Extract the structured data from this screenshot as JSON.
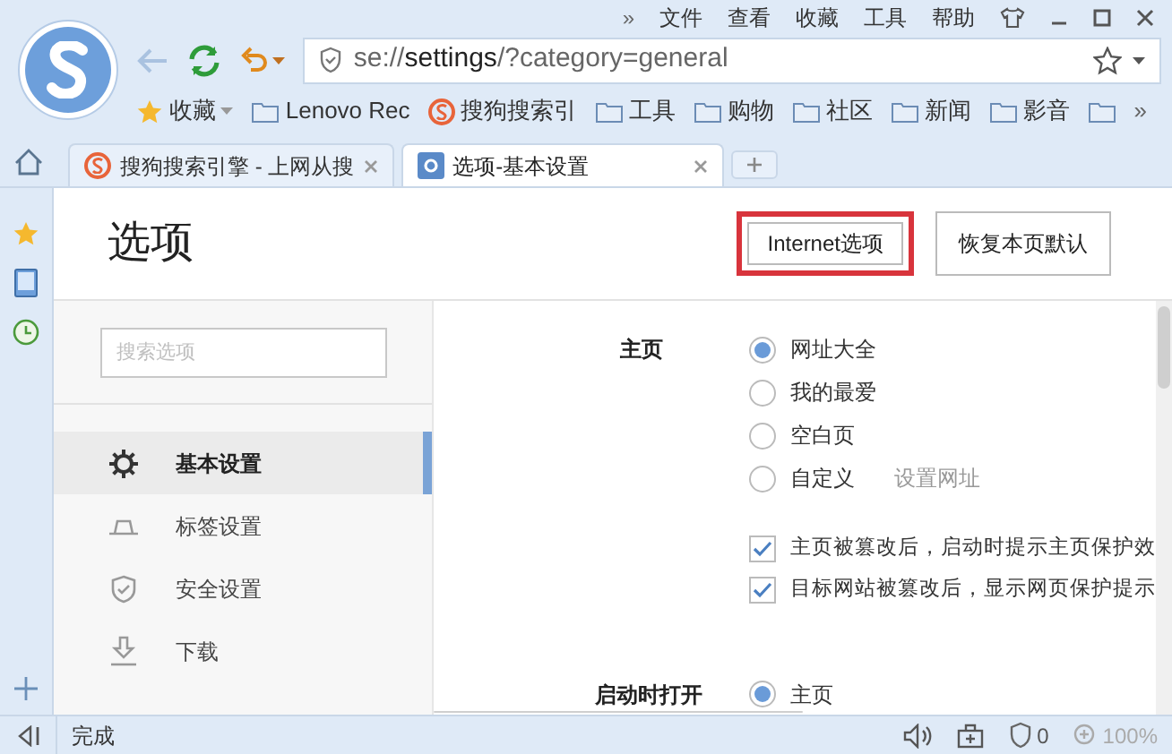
{
  "menu_bar": {
    "overflow": "»",
    "items": [
      "文件",
      "查看",
      "收藏",
      "工具",
      "帮助"
    ]
  },
  "address_bar": {
    "prefix": "se://",
    "bold": "settings",
    "suffix": "/?category=general"
  },
  "bookmarks": {
    "items": [
      {
        "kind": "favorites",
        "label": "收藏"
      },
      {
        "kind": "folder",
        "label": "Lenovo Rec"
      },
      {
        "kind": "site",
        "label": "搜狗搜索引"
      },
      {
        "kind": "folder",
        "label": "工具"
      },
      {
        "kind": "folder",
        "label": "购物"
      },
      {
        "kind": "folder",
        "label": "社区"
      },
      {
        "kind": "folder",
        "label": "新闻"
      },
      {
        "kind": "folder",
        "label": "影音"
      },
      {
        "kind": "folder"
      }
    ],
    "overflow": "»"
  },
  "tabs": [
    {
      "kind": "site",
      "label": "搜狗搜索引擎 - 上网从搜",
      "selected": false
    },
    {
      "kind": "settings",
      "label": "选项-基本设置",
      "selected": true
    }
  ],
  "page": {
    "title": "选项",
    "buttons": [
      {
        "label": "Internet选项",
        "highlighted": true
      },
      {
        "label": "恢复本页默认",
        "highlighted": false
      }
    ],
    "search": {
      "placeholder": "搜索选项"
    },
    "nav": [
      {
        "kind": "gear",
        "label": "基本设置",
        "selected": true
      },
      {
        "kind": "tab",
        "label": "标签设置",
        "selected": false
      },
      {
        "kind": "shield",
        "label": "安全设置",
        "selected": false
      },
      {
        "kind": "download",
        "label": "下载",
        "selected": false
      }
    ],
    "homepage": {
      "label": "主页",
      "options": [
        {
          "label": "网址大全",
          "selected": true
        },
        {
          "label": "我的最爱",
          "selected": false
        },
        {
          "label": "空白页",
          "selected": false
        },
        {
          "label": "自定义",
          "selected": false
        }
      ],
      "link": "设置网址",
      "checks": [
        {
          "label": "主页被篡改后，启动时提示主页保护效",
          "checked": true
        },
        {
          "label": "目标网站被篡改后，显示网页保护提示",
          "checked": true
        }
      ]
    },
    "startup": {
      "label": "启动时打开",
      "options": [
        {
          "label": "主页",
          "selected": true
        }
      ]
    }
  },
  "status_bar": {
    "text": "完成",
    "blocked_count": "0",
    "zoom": "100%"
  }
}
